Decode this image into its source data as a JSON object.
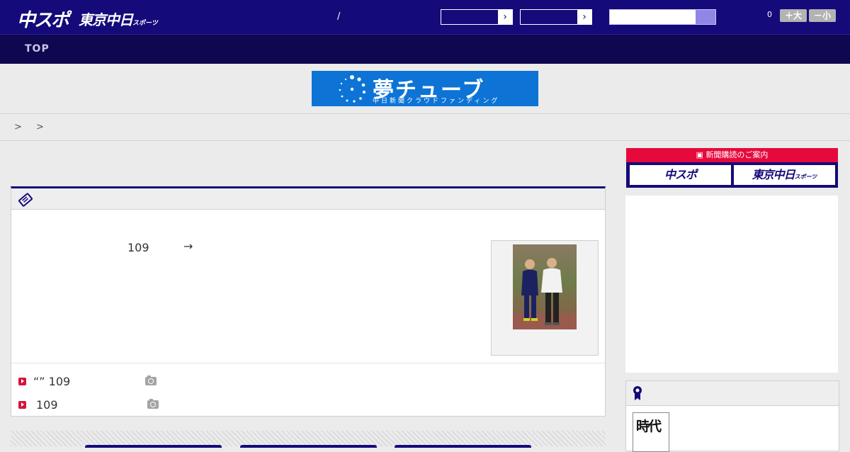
{
  "header": {
    "logo_primary": "中スポ",
    "logo_secondary": "東京中日",
    "logo_secondary_suffix": "スポーツ",
    "separator": "/",
    "select_arrow": "›",
    "comment_count": "0",
    "font_larger": "＋大",
    "font_smaller": "－小"
  },
  "nav": {
    "top_label": "TOP"
  },
  "banner": {
    "title": "夢チューブ",
    "subtitle": "中日新聞クラウドファンディング"
  },
  "breadcrumb": {
    "text": "> >"
  },
  "article": {
    "number": "109",
    "arrow": "→"
  },
  "related": [
    {
      "text": "“” 109"
    },
    {
      "text": "109"
    }
  ],
  "subscribe": {
    "heading": "新聞購読のご案内",
    "chuspo": "中スポ",
    "tokyo": "東京中日",
    "tokyo_suffix": "スポーツ"
  },
  "ranking": {
    "thumb_text": "時代"
  },
  "colors": {
    "header_bg": "#140a7a",
    "nav_bg": "#0f074f",
    "accent_red": "#e60a3c",
    "banner_blue": "#0d74d6"
  }
}
